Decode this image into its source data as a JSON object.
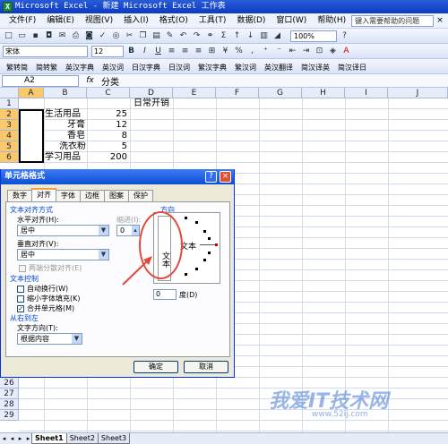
{
  "window": {
    "title": "Microsoft Excel - 新建 Microsoft Excel 工作表",
    "app_icon": "X"
  },
  "menubar": {
    "items": [
      "文件(F)",
      "编辑(E)",
      "视图(V)",
      "插入(I)",
      "格式(O)",
      "工具(T)",
      "数据(D)",
      "窗口(W)",
      "帮助(H)"
    ],
    "help_placeholder": "键入需要帮助的问题",
    "close": "×"
  },
  "toolbar": {
    "zoom": "100%",
    "font": "宋体",
    "size": "12",
    "bold": "B",
    "italic": "I",
    "underline": "U"
  },
  "toolbar3": {
    "items": [
      "繁转简",
      "简转繁",
      "英汉字典",
      "英汉词",
      "日汉字典",
      "日汉词",
      "繁汉字典",
      "繁汉词",
      "英汉翻译",
      "简汉译英",
      "简汉译日",
      "简汉译日"
    ]
  },
  "formula_bar": {
    "name_box": "A2",
    "fx": "fx",
    "content": "分类"
  },
  "columns": [
    "A",
    "B",
    "C",
    "D",
    "E",
    "F",
    "G",
    "H",
    "I",
    "J"
  ],
  "rows": [
    "1",
    "2",
    "3",
    "4",
    "5",
    "6",
    "26",
    "27",
    "28",
    "29"
  ],
  "cells": {
    "d1": "日常开销",
    "b2": "生活用品",
    "c2": "25",
    "b3": "牙膏",
    "c3": "12",
    "b4": "香皂",
    "c4": "8",
    "b5": "洗衣粉",
    "c5": "5",
    "b6": "学习用品",
    "c6": "200"
  },
  "dialog": {
    "title": "单元格格式",
    "help": "?",
    "close": "×",
    "tabs": [
      "数字",
      "对齐",
      "字体",
      "边框",
      "图案",
      "保护"
    ],
    "active_tab": "对齐",
    "text_alignment_group": "文本对齐方式",
    "horizontal_label": "水平对齐(H):",
    "horizontal_value": "居中",
    "indent_label": "缩进(I):",
    "indent_value": "0",
    "vertical_label": "垂直对齐(V):",
    "vertical_value": "居中",
    "justify_distributed": "两端分散对齐(E)",
    "text_control_group": "文本控制",
    "wrap_text": "自动换行(W)",
    "shrink_to_fit": "缩小字体填充(K)",
    "merge_cells": "合并单元格(M)",
    "rtl_group": "从右到左",
    "text_direction_label": "文字方向(T):",
    "text_direction_value": "根据内容",
    "orientation_group": "方向",
    "vertical_text": "文本",
    "dial_text": "文本",
    "degrees_value": "0",
    "degrees_label": "度(D)",
    "ok": "确定",
    "cancel": "取消"
  },
  "sheets": [
    "Sheet1",
    "Sheet2",
    "Sheet3"
  ],
  "active_sheet": "Sheet1",
  "watermark": {
    "main": "我爱IT技术网",
    "sub": "www.52ij.com"
  },
  "colors": {
    "title": "#0a3bc2",
    "selection_header": "#f9c96b",
    "annotation": "#e04a3a"
  }
}
